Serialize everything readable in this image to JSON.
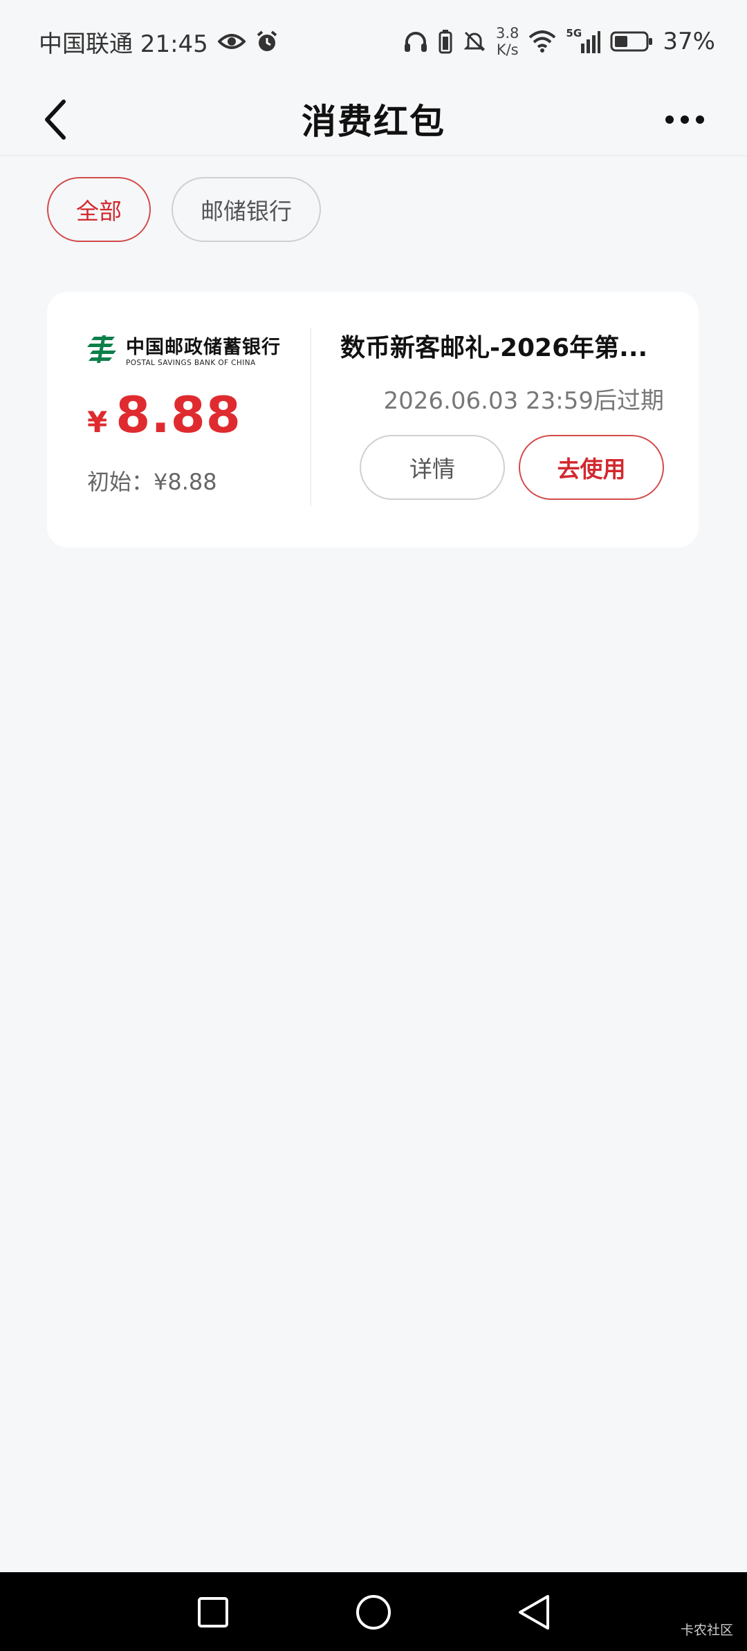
{
  "status_bar": {
    "carrier_time": "中国联通 21:45",
    "net_speed_value": "3.8",
    "net_speed_unit": "K/s",
    "network": "5G",
    "battery": "37%"
  },
  "header": {
    "title": "消费红包"
  },
  "filters": [
    {
      "label": "全部",
      "active": true
    },
    {
      "label": "邮储银行",
      "active": false
    }
  ],
  "coupon": {
    "bank_name_cn": "中国邮政储蓄银行",
    "bank_name_en": "POSTAL SAVINGS BANK OF CHINA",
    "currency": "¥",
    "amount": "8.88",
    "initial_text": "初始：¥8.88",
    "title": "数币新客邮礼-2026年第...",
    "expire_text": "2026.06.03 23:59后过期",
    "detail_label": "详情",
    "use_label": "去使用"
  },
  "colors": {
    "accent": "#df2b2f",
    "background": "#f6f7f9",
    "card": "#ffffff",
    "bank_green": "#0e7f4a"
  },
  "watermark": "卡农社区"
}
